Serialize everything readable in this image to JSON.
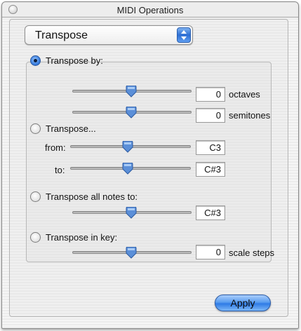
{
  "window": {
    "title": "MIDI Operations"
  },
  "operation_popup": {
    "selected": "Transpose"
  },
  "transpose_by": {
    "label": "Transpose by:",
    "selected": true,
    "octaves": {
      "value": "0",
      "unit": "octaves",
      "slider_fraction": 0.5
    },
    "semitones": {
      "value": "0",
      "unit": "semitones",
      "slider_fraction": 0.5
    }
  },
  "transpose_from_to": {
    "label": "Transpose...",
    "selected": false,
    "from": {
      "label": "from:",
      "value": "C3",
      "slider_fraction": 0.5
    },
    "to": {
      "label": "to:",
      "value": "C#3",
      "slider_fraction": 0.5
    }
  },
  "transpose_all": {
    "label": "Transpose all notes to:",
    "selected": false,
    "value": "C#3",
    "slider_fraction": 0.5
  },
  "transpose_in_key": {
    "label": "Transpose in key:",
    "selected": false,
    "value": "0",
    "unit": "scale steps",
    "slider_fraction": 0.5
  },
  "apply_button": {
    "label": "Apply"
  },
  "colors": {
    "accent": "#3a7fe0",
    "thumb": "#5b8fd8"
  },
  "icons": {
    "close": "close-icon",
    "popup": "popup-arrows-icon",
    "slider_thumb": "slider-thumb-icon"
  }
}
